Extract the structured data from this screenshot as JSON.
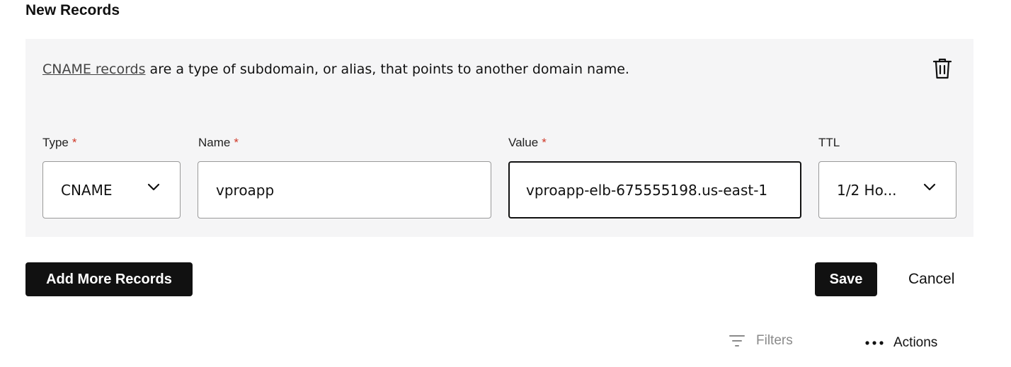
{
  "page": {
    "heading": "New Records"
  },
  "record": {
    "description_link": "CNAME records",
    "description_text": " are a type of subdomain, or alias, that points to another domain name.",
    "fields": {
      "type": {
        "label": "Type",
        "required_mark": "*",
        "value": "CNAME"
      },
      "name": {
        "label": "Name",
        "required_mark": "*",
        "value": "vproapp"
      },
      "value": {
        "label": "Value",
        "required_mark": "*",
        "value": "vproapp-elb-675555198.us-east-1"
      },
      "ttl": {
        "label": "TTL",
        "value": "1/2 Ho..."
      }
    }
  },
  "actions": {
    "add_more": "Add More Records",
    "save": "Save",
    "cancel": "Cancel"
  },
  "toolbar": {
    "filters": "Filters",
    "actions": "Actions"
  },
  "icons": {
    "delete": "trash-icon",
    "dropdown": "chevron-down-icon",
    "filters": "filter-icon",
    "more": "more-horizontal-icon"
  },
  "colors": {
    "required": "#d03a2a",
    "button": "#111111",
    "panel": "#f5f5f6",
    "muted": "#8a8a8a"
  }
}
